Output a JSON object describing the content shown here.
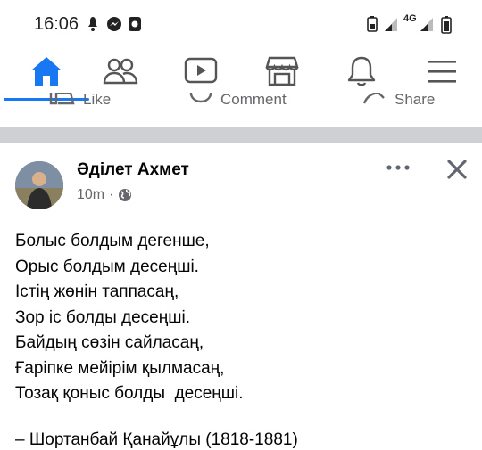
{
  "status_bar": {
    "time": "16:06",
    "network": "4G",
    "icons": [
      "notification-icon",
      "messenger-icon",
      "app-icon",
      "battery-icon",
      "signal-icon",
      "wifi-icon"
    ]
  },
  "nav": {
    "tabs": [
      "home-icon",
      "friends-icon",
      "watch-icon",
      "marketplace-icon",
      "notifications-icon",
      "menu-icon"
    ],
    "active_color": "#1877f2"
  },
  "reactions": {
    "like": "Like",
    "comment": "Comment",
    "share": "Share"
  },
  "post": {
    "author": "Әділет Ахмет",
    "time": "10m",
    "separator": "·",
    "audience_icon": "globe-icon",
    "lines": [
      "Болыс болдым дегенше,",
      "Орыс болдым десеңші.",
      "Істің жөнін таппасаң,",
      "Зор іс болды десеңші.",
      "Байдың сөзін сайласаң,",
      "Ғаріпке мейірім қылмасаң,",
      "Тозақ қоныс болды  десеңші."
    ],
    "attribution": "– Шортанбай Қанайұлы (1818-1881)"
  }
}
